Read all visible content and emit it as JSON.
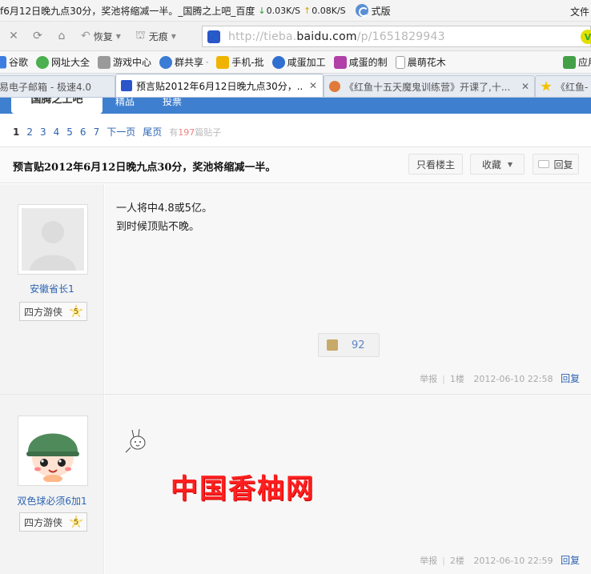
{
  "window": {
    "title": "f6月12日晚九点30分，奖池将缩减一半。_国腾之上吧_百度",
    "speed_down": "0.03K/S",
    "speed_up": "0.08K/S",
    "mode_text": "式版",
    "menu_file": "文件"
  },
  "nav": {
    "restore_label": "恢复",
    "notrace_label": "无痕",
    "url_prefix": "http://tieba.",
    "url_domain": "baidu.com",
    "url_path": "/p/1651829943"
  },
  "bookmarks": [
    {
      "label": "谷歌",
      "color": "#3b7de0"
    },
    {
      "label": "网址大全",
      "color": "#4caf50"
    },
    {
      "label": "游戏中心",
      "color": "#888888"
    },
    {
      "label": "群共享",
      "color": "#3a7bd5"
    },
    {
      "label": "手机-批",
      "color": "#f0b400"
    },
    {
      "label": "咸蛋加工",
      "color": "#2f6fcf"
    },
    {
      "label": "咸蛋的制",
      "color": "#b03fa8"
    },
    {
      "label": "晨萌花木",
      "color": "#9e9e9e"
    },
    {
      "label": "应用",
      "color": "#43a047"
    }
  ],
  "tabs": [
    {
      "label": "易电子邮箱 - 极速4.0",
      "icon_color": "#c0c0c0"
    },
    {
      "label": "预言贴2012年6月12日晚九点30分，...",
      "icon_color": "#2b55c9"
    },
    {
      "label": "《红鱼十五天魔鬼训练营》开课了,十...",
      "icon_color": "#e07a3a"
    },
    {
      "label": "《红鱼-",
      "icon_color": "#f2c200"
    }
  ],
  "forum_nav": {
    "active": "国腾之上吧",
    "items": [
      "精品",
      "投票"
    ]
  },
  "pager": {
    "current": "1",
    "pages": [
      "2",
      "3",
      "4",
      "5",
      "6",
      "7"
    ],
    "next": "下一页",
    "last": "尾页",
    "info_prefix": "有",
    "info_count": "197",
    "info_suffix": "篇贴子"
  },
  "thread": {
    "title": "预言贴2012年6月12日晚九点30分，奖池将缩减一半。",
    "btn_author_only": "只看楼主",
    "btn_collect": "收藏",
    "btn_reply": "回复"
  },
  "posts": [
    {
      "username": "安徽省长1",
      "level_title": "四方游侠",
      "level": "5",
      "lines": [
        "一人将中4.8或5亿。",
        "到时候顶贴不晚。"
      ],
      "likes": "92",
      "report": "举报",
      "floor": "1楼",
      "time": "2012-06-10 22:58",
      "reply": "回复"
    },
    {
      "username": "双色球必须6加1",
      "level_title": "四方游侠",
      "level": "5",
      "report": "举报",
      "floor": "2楼",
      "time": "2012-06-10 22:59",
      "reply": "回复"
    }
  ],
  "watermark": "中国香柚网"
}
